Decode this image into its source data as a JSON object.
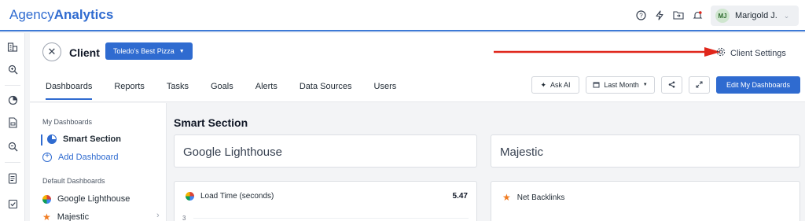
{
  "brand": {
    "name_light": "Agency",
    "name_bold": "Analytics"
  },
  "topbar": {
    "icons": [
      "help-icon",
      "bolt-icon",
      "folder-icon",
      "bell-icon"
    ],
    "user": {
      "initials": "MJ",
      "name": "Marigold J."
    }
  },
  "rail": {
    "icons": [
      "building-icon",
      "search-icon",
      "pie-chart-icon",
      "file-icon",
      "zoom-icon",
      "document-icon",
      "checkbox-icon"
    ]
  },
  "header": {
    "client_label": "Client",
    "client_name": "Toledo's Best Pizza",
    "client_settings": "Client Settings",
    "tabs": [
      "Dashboards",
      "Reports",
      "Tasks",
      "Goals",
      "Alerts",
      "Data Sources",
      "Users"
    ],
    "active_tab": "Dashboards",
    "actions": {
      "ask_ai": "Ask AI",
      "date_range": "Last Month",
      "edit": "Edit My Dashboards"
    }
  },
  "sidebar": {
    "my_dashboards_label": "My Dashboards",
    "active_item": "Smart Section",
    "add_dashboard": "Add Dashboard",
    "default_label": "Default Dashboards",
    "default_items": [
      "Google Lighthouse",
      "Majestic"
    ]
  },
  "main": {
    "section_title": "Smart Section",
    "cards": [
      {
        "title": "Google Lighthouse"
      },
      {
        "title": "Majestic"
      }
    ],
    "metrics": [
      {
        "label": "Load Time (seconds)",
        "value": "5.47",
        "axis_tick": "3"
      },
      {
        "label": "Net Backlinks"
      }
    ]
  },
  "colors": {
    "accent": "#2f6bd0",
    "arrow": "#e0261b",
    "star": "#f07c22"
  }
}
